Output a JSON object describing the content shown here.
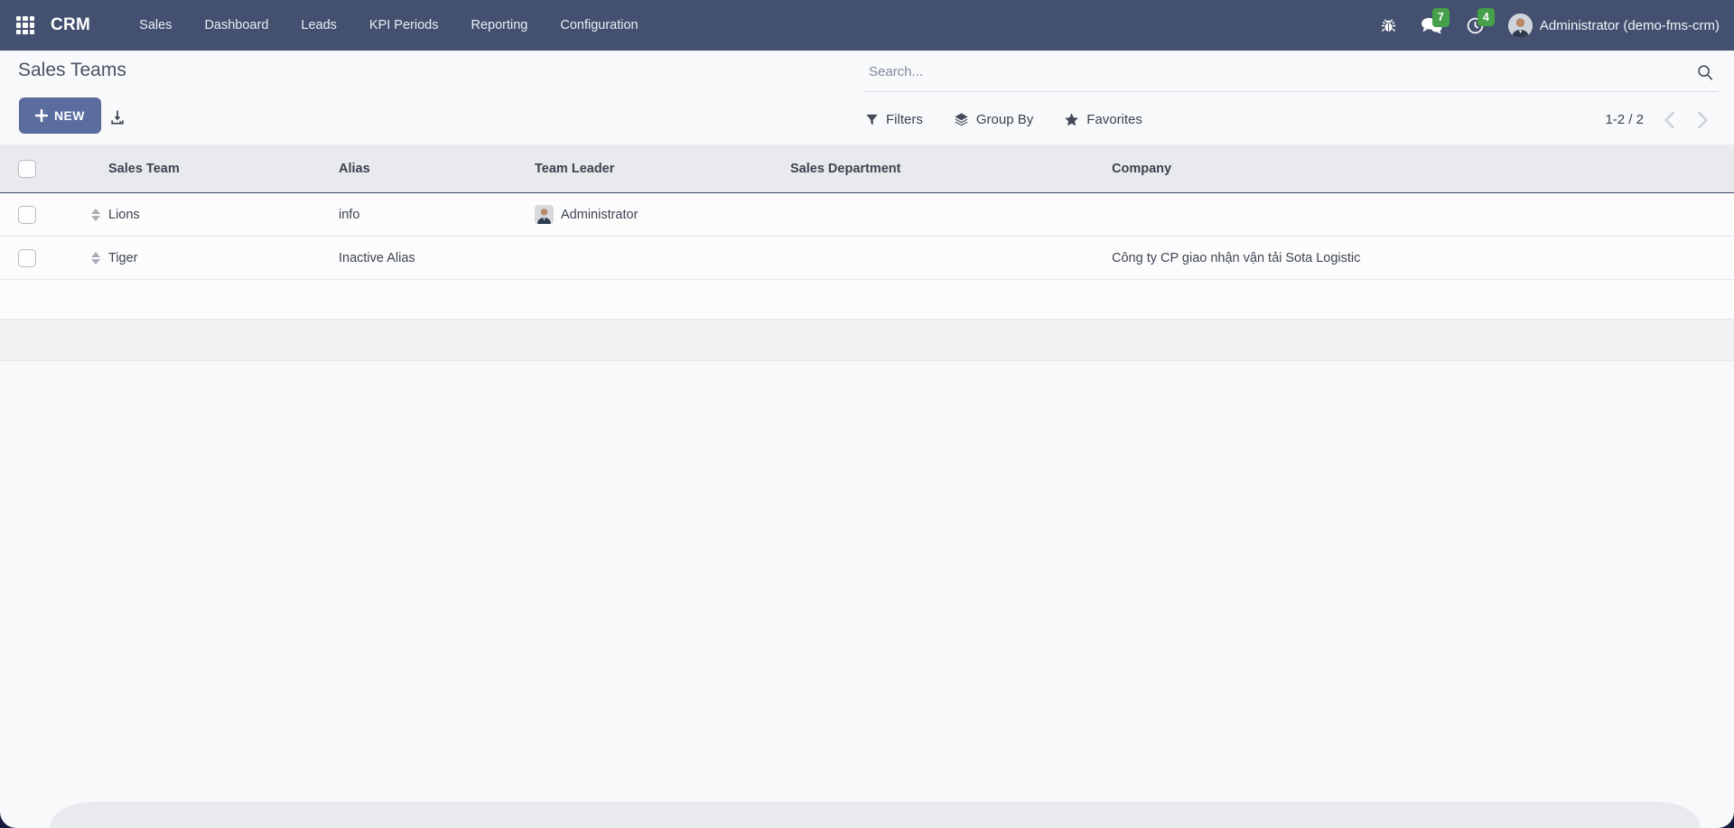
{
  "navbar": {
    "app_name": "CRM",
    "menu_items": [
      "Sales",
      "Dashboard",
      "Leads",
      "KPI Periods",
      "Reporting",
      "Configuration"
    ],
    "message_count": "7",
    "activity_count": "4",
    "user_name": "Administrator (demo-fms-crm)",
    "colors": {
      "background": "#43506f",
      "badge_green": "#45a049"
    }
  },
  "header": {
    "title": "Sales Teams",
    "search_placeholder": "Search..."
  },
  "toolbar": {
    "new_label": "NEW",
    "filters_label": "Filters",
    "group_by_label": "Group By",
    "favorites_label": "Favorites",
    "pager_text": "1-2 / 2",
    "accent_color": "#5b6c9f"
  },
  "table": {
    "columns": [
      "Sales Team",
      "Alias",
      "Team Leader",
      "Sales Department",
      "Company"
    ],
    "rows": [
      {
        "sales_team": "Lions",
        "alias": "info",
        "team_leader": "Administrator",
        "sales_department": "",
        "company": ""
      },
      {
        "sales_team": "Tiger",
        "alias": "Inactive Alias",
        "team_leader": "",
        "sales_department": "",
        "company": "Công ty CP giao nhận vận tải Sota Logistic"
      }
    ]
  },
  "icons": {
    "apps": "grid-3x3",
    "bug": "debug",
    "messages": "chat-bubbles",
    "activities": "clock",
    "export": "download-tray",
    "filters": "funnel",
    "group_by": "layers",
    "favorites": "star",
    "search": "magnifier",
    "pager_prev": "chevron-left",
    "pager_next": "chevron-right",
    "row_drag": "up-down-arrows"
  }
}
